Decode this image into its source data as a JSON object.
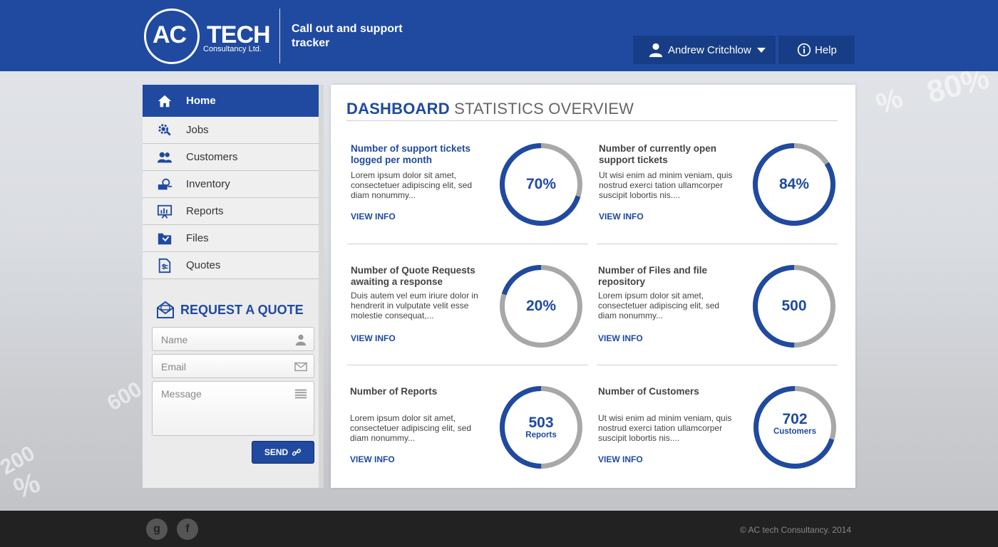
{
  "header": {
    "logo_main_a": "AC",
    "logo_main_b": "TECH",
    "logo_sub": "Consultancy Ltd.",
    "title": "Call out and support tracker",
    "user_name": "Andrew Critchlow",
    "help_label": "Help"
  },
  "sidebar": {
    "items": [
      {
        "label": "Home",
        "icon": "home-icon",
        "active": true
      },
      {
        "label": "Jobs",
        "icon": "gear-search-icon"
      },
      {
        "label": "Customers",
        "icon": "users-icon"
      },
      {
        "label": "Inventory",
        "icon": "inventory-icon"
      },
      {
        "label": "Reports",
        "icon": "presentation-icon"
      },
      {
        "label": "Files",
        "icon": "folder-icon"
      },
      {
        "label": "Quotes",
        "icon": "quote-document-icon"
      }
    ],
    "quote": {
      "title": "REQUEST A QUOTE",
      "name_placeholder": "Name",
      "email_placeholder": "Email",
      "message_placeholder": "Message",
      "send_label": "SEND"
    }
  },
  "main": {
    "title_bold": "DASHBOARD",
    "title_light": "STATISTICS OVERVIEW",
    "stats": [
      {
        "title": "Number of support tickets logged per month",
        "desc": "Lorem ipsum dolor sit amet, consectetuer adipiscing elit, sed diam nonummy...",
        "link": "VIEW INFO",
        "value": "70%",
        "sub": "",
        "fraction": 0.7
      },
      {
        "title": "Number of currently open support tickets",
        "desc": "Ut wisi enim ad minim veniam, quis nostrud exerci tation ullamcorper suscipit lobortis nis....",
        "link": "VIEW INFO",
        "value": "84%",
        "sub": "",
        "fraction": 0.84
      },
      {
        "title": "Number of Quote Requests awaiting a response",
        "desc": "Duis autem vel eum iriure dolor in hendrerit in vulputate velit esse molestie consequat,...",
        "link": "VIEW INFO",
        "value": "20%",
        "sub": "",
        "fraction": 0.2
      },
      {
        "title": "Number of Files and file repository",
        "desc": "Lorem ipsum dolor sit amet, consectetuer adipiscing elit, sed diam nonummy...",
        "link": "VIEW INFO",
        "value": "500",
        "sub": "",
        "fraction": 0.5
      },
      {
        "title": "Number of Reports",
        "desc": "Lorem ipsum dolor sit amet, consectetuer adipiscing elit, sed diam nonummy...",
        "link": "VIEW INFO",
        "value": "503",
        "sub": "Reports",
        "fraction": 0.5
      },
      {
        "title": "Number of Customers",
        "desc": "Ut wisi enim ad minim veniam, quis nostrud exerci tation ullamcorper suscipit lobortis nis....",
        "link": "VIEW INFO",
        "value": "702",
        "sub": "Customers",
        "fraction": 0.7
      }
    ]
  },
  "footer": {
    "social": [
      {
        "label": "g",
        "icon": "google-icon"
      },
      {
        "label": "f",
        "icon": "facebook-icon"
      }
    ],
    "copyright": "© AC tech Consultancy. 2014"
  },
  "colors": {
    "brand_blue": "#1f4aa0",
    "ring_track": "#a8a8a8",
    "footer_bg": "#222222"
  }
}
